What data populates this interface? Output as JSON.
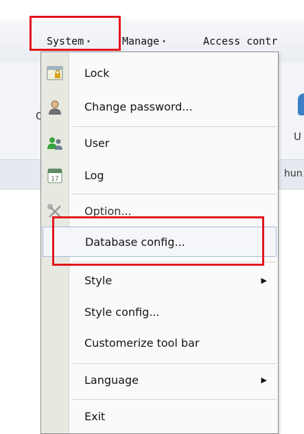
{
  "menubar": {
    "items": [
      {
        "label": "System",
        "caret": "▾"
      },
      {
        "label": "Manage",
        "caret": "▾"
      },
      {
        "label": "Access contr"
      }
    ]
  },
  "background": {
    "letter_c": "C",
    "letter_u": "U",
    "partial_text": "hun"
  },
  "menu": {
    "items": [
      {
        "label": "Lock",
        "icon": "lock-icon"
      },
      {
        "label": "Change password...",
        "icon": "person-icon"
      },
      {
        "label": "User",
        "icon": "users-icon"
      },
      {
        "label": "Log",
        "icon": "calendar-icon",
        "icon_text": "17"
      },
      {
        "label": "Option...",
        "icon": "tools-icon"
      },
      {
        "label": "Database config...",
        "selected": true
      },
      {
        "label": "Style",
        "submenu": true
      },
      {
        "label": "Style config..."
      },
      {
        "label": "Customerize tool bar"
      },
      {
        "label": "Language",
        "submenu": true
      },
      {
        "label": "Exit"
      }
    ],
    "submenu_arrow": "▶"
  },
  "colors": {
    "highlight_box": "#e3141b",
    "icon_strip": "#e7e9e1",
    "selected_border": "#a9b8d6"
  }
}
